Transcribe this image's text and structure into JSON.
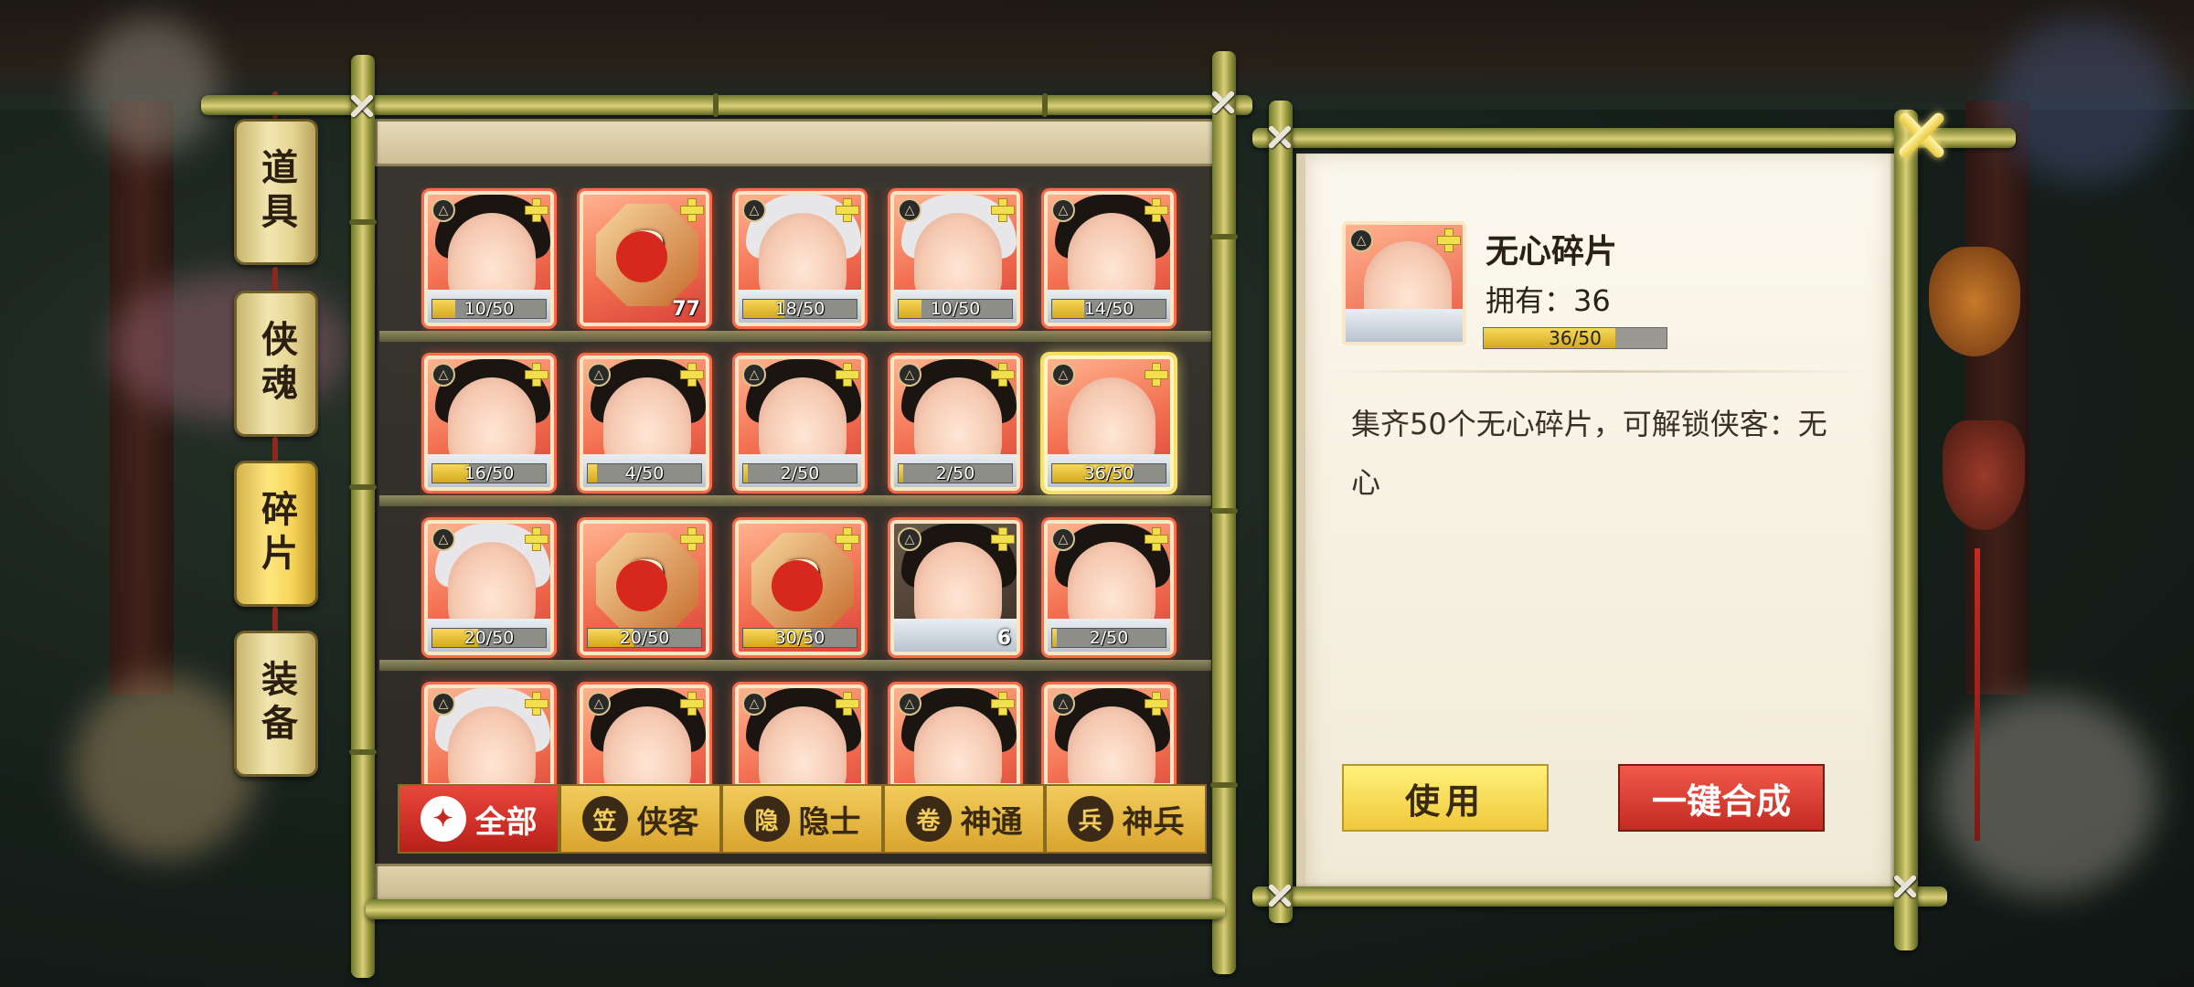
{
  "tabs": [
    {
      "label": "道具",
      "active": false
    },
    {
      "label": "侠魂",
      "active": false
    },
    {
      "label": "碎片",
      "active": true
    },
    {
      "label": "装备",
      "active": false
    }
  ],
  "filters": [
    {
      "label": "全部",
      "icon": "✦",
      "active": true
    },
    {
      "label": "侠客",
      "icon": "笠",
      "active": false
    },
    {
      "label": "隐士",
      "icon": "隐",
      "active": false
    },
    {
      "label": "神通",
      "icon": "卷",
      "active": false
    },
    {
      "label": "神兵",
      "icon": "兵",
      "active": false
    }
  ],
  "items": [
    {
      "type": "hero",
      "hair": "dark",
      "progress": "10/50",
      "ratio": 0.2
    },
    {
      "type": "mystery",
      "count": "77"
    },
    {
      "type": "hero",
      "hair": "white",
      "progress": "18/50",
      "ratio": 0.36
    },
    {
      "type": "hero",
      "hair": "white",
      "progress": "10/50",
      "ratio": 0.2
    },
    {
      "type": "hero",
      "hair": "dark",
      "progress": "14/50",
      "ratio": 0.28
    },
    {
      "type": "hero",
      "hair": "dark",
      "progress": "16/50",
      "ratio": 0.32
    },
    {
      "type": "hero",
      "hair": "dark",
      "progress": "4/50",
      "ratio": 0.08
    },
    {
      "type": "hero",
      "hair": "dark",
      "progress": "2/50",
      "ratio": 0.04
    },
    {
      "type": "hero",
      "hair": "dark",
      "progress": "2/50",
      "ratio": 0.04
    },
    {
      "type": "hero",
      "hair": "bald",
      "progress": "36/50",
      "ratio": 0.72,
      "selected": true
    },
    {
      "type": "hero",
      "hair": "white",
      "progress": "20/50",
      "ratio": 0.4
    },
    {
      "type": "mystery",
      "progress": "20/50",
      "ratio": 0.4
    },
    {
      "type": "mystery",
      "progress": "30/50",
      "ratio": 0.6
    },
    {
      "type": "hero",
      "hair": "dark",
      "dark": true,
      "count": "6"
    },
    {
      "type": "hero",
      "hair": "dark",
      "progress": "2/50",
      "ratio": 0.04
    },
    {
      "type": "hero",
      "hair": "white"
    },
    {
      "type": "hero",
      "hair": "dark"
    },
    {
      "type": "hero",
      "hair": "dark"
    },
    {
      "type": "hero",
      "hair": "dark"
    },
    {
      "type": "hero",
      "hair": "dark"
    }
  ],
  "detail": {
    "title": "无心碎片",
    "own": "拥有：36",
    "progress": "36/50",
    "ratio": 0.72,
    "description": "集齐50个无心碎片，可解锁侠客：无心"
  },
  "buttons": {
    "use": "使用",
    "merge": "一键合成"
  },
  "colors": {
    "accent_red": "#c42a22",
    "accent_gold": "#f0c83a",
    "card_red": "#f26d4f"
  }
}
